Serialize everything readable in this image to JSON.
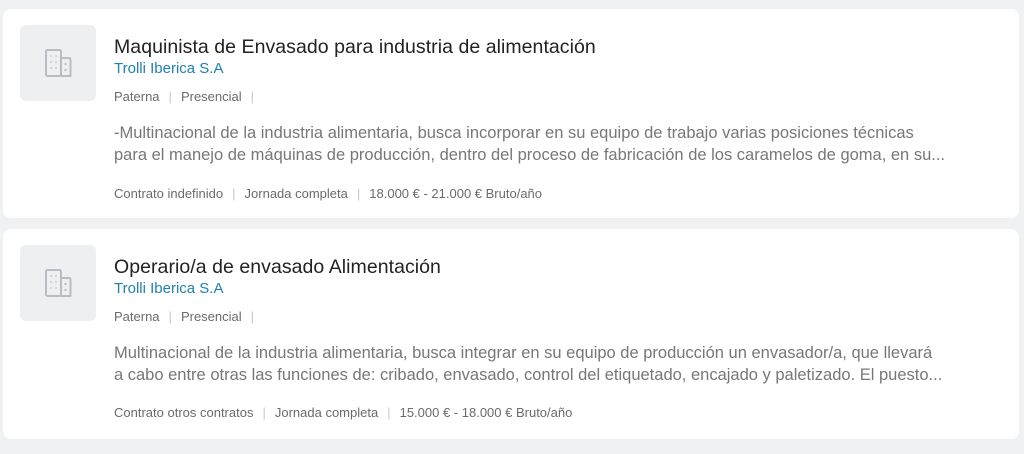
{
  "offers": [
    {
      "title": "Maquinista de Envasado para industria de alimentación",
      "company": "Trolli Iberica S.A",
      "location": "Paterna",
      "modality": "Presencial",
      "description_line1": "-Multinacional de la industria alimentaria, busca incorporar en su equipo de trabajo varias posiciones técnicas",
      "description_line2": "para el manejo de máquinas de producción, dentro del proceso de fabricación de los caramelos de goma, en su...",
      "contract": "Contrato indefinido",
      "workday": "Jornada completa",
      "salary": "18.000 € - 21.000 € Bruto/año",
      "logo_icon": "building-icon"
    },
    {
      "title": "Operario/a de envasado Alimentación",
      "company": "Trolli Iberica S.A",
      "location": "Paterna",
      "modality": "Presencial",
      "description_line1": "Multinacional de la industria alimentaria, busca integrar en su equipo de producción un envasador/a, que llevará",
      "description_line2": "a cabo entre otras las funciones de: cribado, envasado, control del etiquetado, encajado y paletizado. El puesto...",
      "contract": "Contrato otros contratos",
      "workday": "Jornada completa",
      "salary": "15.000 € - 18.000 € Bruto/año",
      "logo_icon": "building-icon"
    }
  ]
}
